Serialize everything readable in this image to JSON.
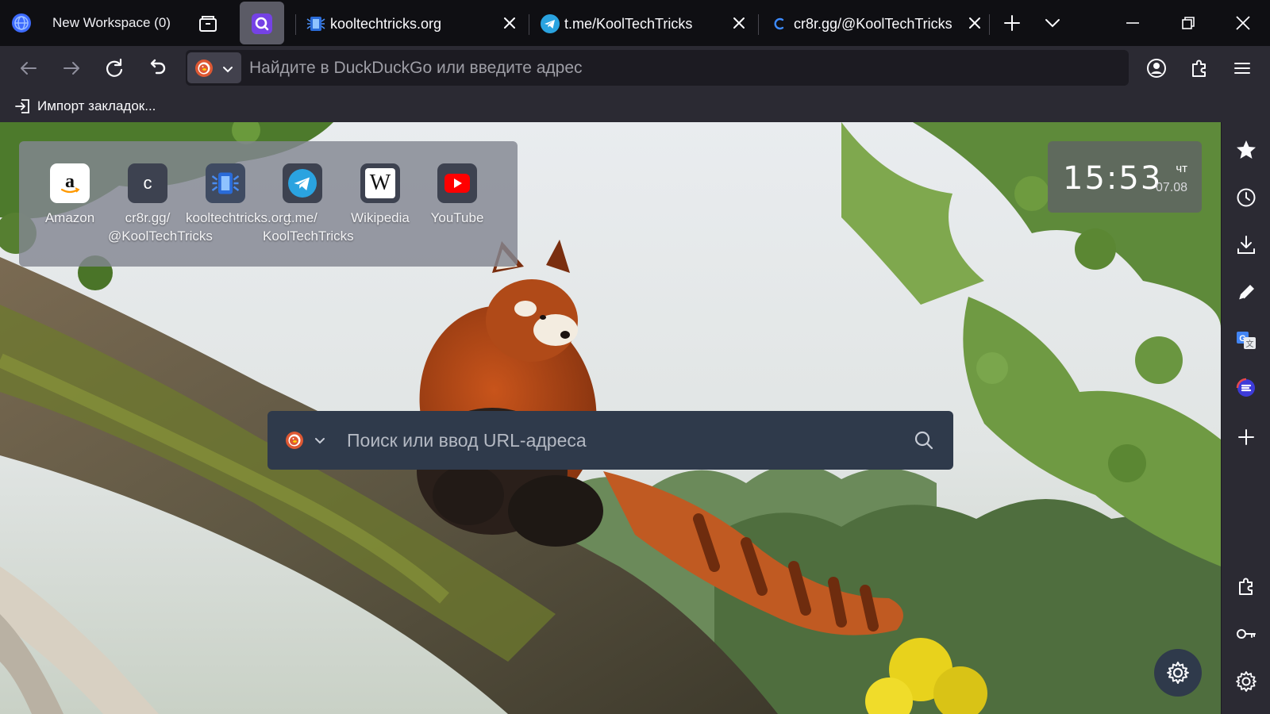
{
  "workspace": {
    "label": "New Workspace (0)"
  },
  "tabs": [
    {
      "title": "kooltechtricks.org",
      "favicon": "kooltechtricks-icon"
    },
    {
      "title": "t.me/KoolTechTricks",
      "favicon": "telegram-icon"
    },
    {
      "title": "cr8r.gg/@KoolTechTricks",
      "favicon": "cr8r-icon"
    }
  ],
  "urlbar": {
    "placeholder": "Найдите в DuckDuckGo или введите адрес",
    "value": ""
  },
  "bookmarks": {
    "import_label": "Импорт закладок..."
  },
  "top_sites": [
    {
      "label": "Amazon",
      "icon": "amazon-icon"
    },
    {
      "label": "cr8r.gg/\n@KoolTechTricks",
      "icon": "cr8r-icon",
      "tile_letter": "c"
    },
    {
      "label": "kooltechtricks.org",
      "icon": "kooltechtricks-icon"
    },
    {
      "label": "t.me/\nKoolTechTricks",
      "icon": "telegram-icon"
    },
    {
      "label": "Wikipedia",
      "icon": "wikipedia-icon"
    },
    {
      "label": "YouTube",
      "icon": "youtube-icon"
    }
  ],
  "clock": {
    "time": "15:53",
    "day": "чт",
    "date": "07.08"
  },
  "search": {
    "placeholder": "Поиск или ввод URL-адреса",
    "value": ""
  },
  "sidebar_icons": [
    "star-icon",
    "history-icon",
    "download-icon",
    "pen-icon",
    "translate-icon",
    "extension-e-icon",
    "add-icon",
    "puzzle-icon",
    "key-icon",
    "gear-icon"
  ],
  "colors": {
    "toolbar": "#2b2a33",
    "tabstrip": "#0f0f13",
    "accent": "#7542e5",
    "search_panel": "#2f3a4b"
  }
}
